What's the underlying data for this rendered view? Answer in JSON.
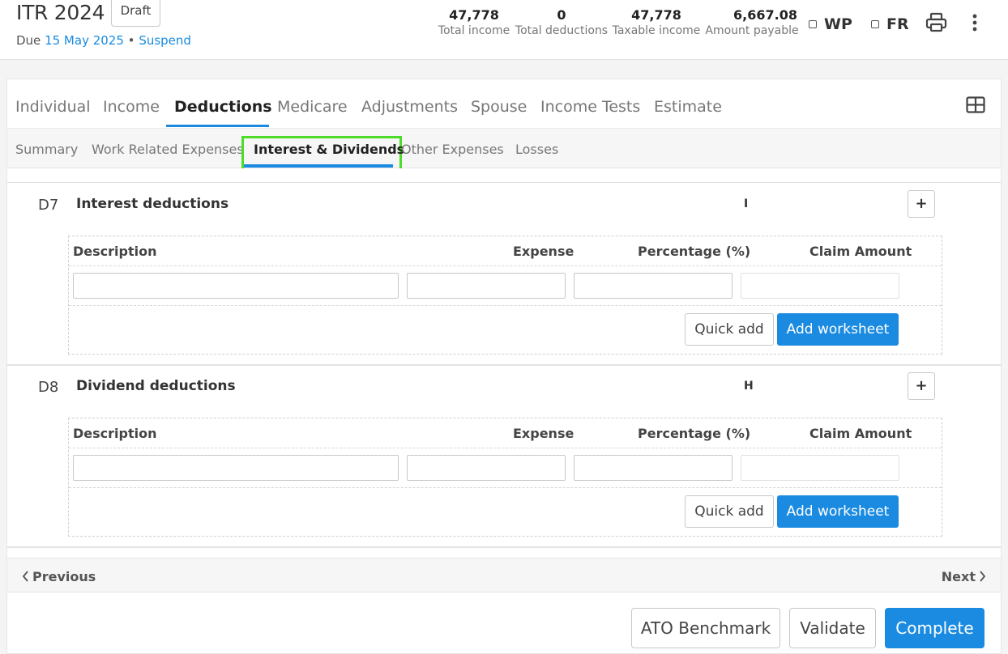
{
  "header": {
    "title": "ITR 2024",
    "status": "Draft",
    "due_label": "Due",
    "due_date": "15 May 2025",
    "separator": "•",
    "suspend_label": "Suspend",
    "stats": [
      {
        "value": "47,778",
        "label": "Total income"
      },
      {
        "value": "0",
        "label": "Total deductions"
      },
      {
        "value": "47,778",
        "label": "Taxable income"
      },
      {
        "value": "6,667.08",
        "label": "Amount payable"
      }
    ],
    "checkboxes": [
      {
        "label": "WP",
        "checked": false
      },
      {
        "label": "FR",
        "checked": false
      }
    ],
    "icons": {
      "print": "printer-icon",
      "more": "more-vertical-icon"
    }
  },
  "tabs": [
    "Individual",
    "Income",
    "Deductions",
    "Medicare",
    "Adjustments",
    "Spouse",
    "Income Tests",
    "Estimate"
  ],
  "active_tab": "Deductions",
  "subtabs": [
    "Summary",
    "Work Related Expenses",
    "Interest & Dividends",
    "Other Expenses",
    "Losses"
  ],
  "active_subtab": "Interest & Dividends",
  "layout_icon": "grid-layout-icon",
  "columns": {
    "description": "Description",
    "expense": "Expense",
    "percentage": "Percentage (%)",
    "claim_amount": "Claim Amount"
  },
  "sections": [
    {
      "code": "D7",
      "title": "Interest deductions",
      "marker": "I",
      "add_symbol": "+",
      "row": {
        "description": "",
        "expense": "",
        "percentage": "",
        "claim_amount": ""
      },
      "quick_add": "Quick add",
      "add_worksheet": "Add worksheet"
    },
    {
      "code": "D8",
      "title": "Dividend deductions",
      "marker": "H",
      "add_symbol": "+",
      "row": {
        "description": "",
        "expense": "",
        "percentage": "",
        "claim_amount": ""
      },
      "quick_add": "Quick add",
      "add_worksheet": "Add worksheet"
    }
  ],
  "pager": {
    "previous": "Previous",
    "next": "Next"
  },
  "footer": {
    "ato_benchmark": "ATO Benchmark",
    "validate": "Validate",
    "complete": "Complete"
  },
  "colors": {
    "accent": "#1a8be0",
    "highlight": "#4ddc2a"
  }
}
